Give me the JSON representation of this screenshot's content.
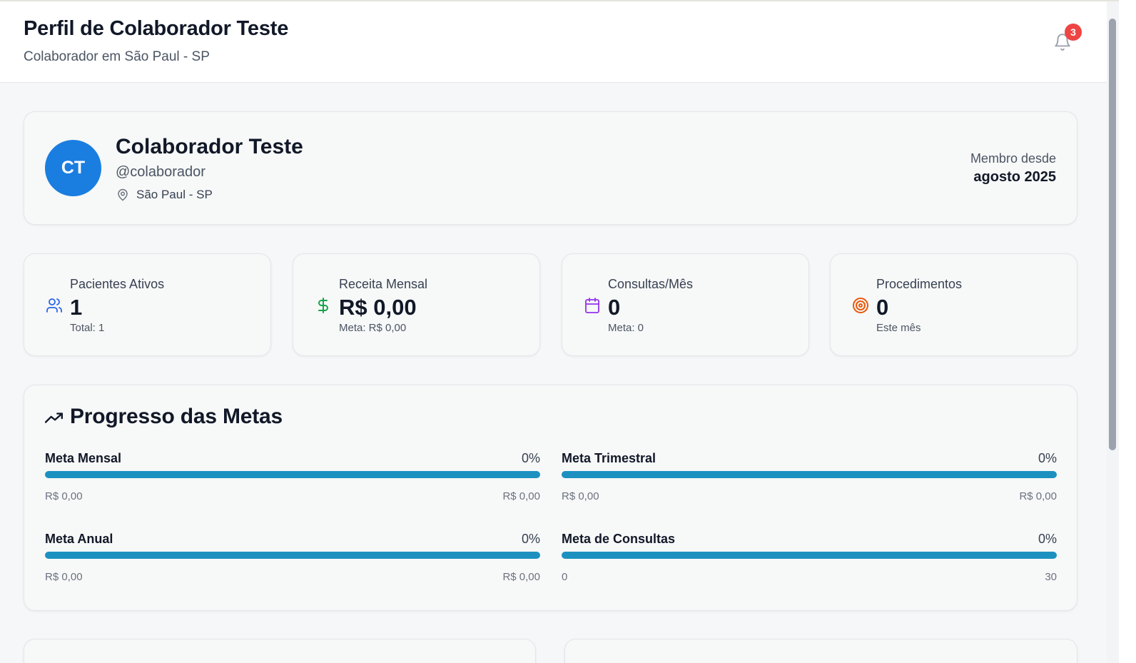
{
  "header": {
    "title": "Perfil de Colaborador Teste",
    "subtitle": "Colaborador em São Paul - SP",
    "notifications_count": "3"
  },
  "profile": {
    "initials": "CT",
    "name": "Colaborador Teste",
    "username": "@colaborador",
    "location": "São Paul - SP",
    "member_since_label": "Membro desde",
    "member_since_value": "agosto 2025"
  },
  "stats": [
    {
      "label": "Pacientes Ativos",
      "value": "1",
      "sub": "Total: 1",
      "icon": "users-icon",
      "color": "#2563eb"
    },
    {
      "label": "Receita Mensal",
      "value": "R$ 0,00",
      "sub": "Meta: R$ 0,00",
      "icon": "dollar-icon",
      "color": "#16a34a"
    },
    {
      "label": "Consultas/Mês",
      "value": "0",
      "sub": "Meta: 0",
      "icon": "calendar-icon",
      "color": "#9333ea"
    },
    {
      "label": "Procedimentos",
      "value": "0",
      "sub": "Este mês",
      "icon": "target-icon",
      "color": "#ea580c"
    }
  ],
  "goals": {
    "title": "Progresso das Metas",
    "items": [
      {
        "name": "Meta Mensal",
        "percent_label": "0%",
        "progress": 0,
        "min": "R$ 0,00",
        "max": "R$ 0,00"
      },
      {
        "name": "Meta Trimestral",
        "percent_label": "0%",
        "progress": 0,
        "min": "R$ 0,00",
        "max": "R$ 0,00"
      },
      {
        "name": "Meta Anual",
        "percent_label": "0%",
        "progress": 0,
        "min": "R$ 0,00",
        "max": "R$ 0,00"
      },
      {
        "name": "Meta de Consultas",
        "percent_label": "0%",
        "progress": 0,
        "min": "0",
        "max": "30"
      }
    ]
  },
  "colors": {
    "accent": "#1a7ee0",
    "progress_bar": "#1c91c0",
    "badge": "#ef4444"
  }
}
